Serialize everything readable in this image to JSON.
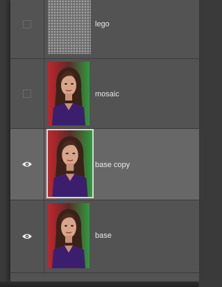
{
  "layers_panel": {
    "layers": [
      {
        "name": "lego",
        "visible": false,
        "selected": false,
        "thumb": "pattern"
      },
      {
        "name": "mosaic",
        "visible": false,
        "selected": false,
        "thumb": "portrait"
      },
      {
        "name": "base copy",
        "visible": true,
        "selected": true,
        "thumb": "portrait"
      },
      {
        "name": "base",
        "visible": true,
        "selected": false,
        "thumb": "portrait"
      }
    ],
    "icons": {
      "visibility_on": "eye-icon",
      "visibility_off": "empty-visibility-box"
    },
    "colors": {
      "panel_bg": "#535353",
      "selected_bg": "#676767",
      "text": "#e8e8e8"
    }
  }
}
